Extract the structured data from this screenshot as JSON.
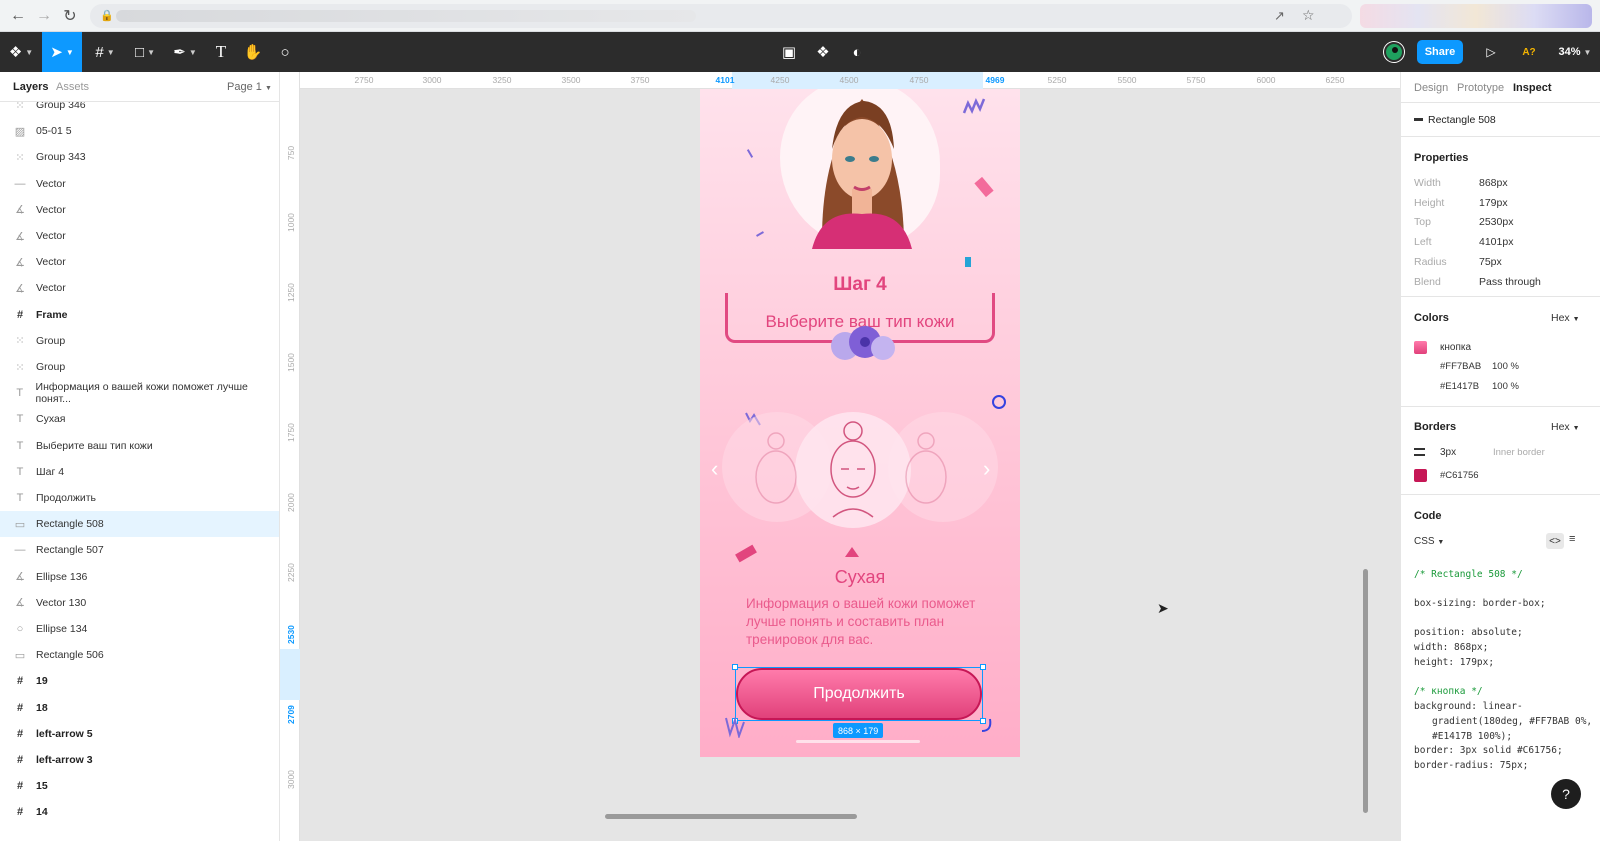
{
  "toolbar": {
    "share_label": "Share",
    "zoom_label": "34%",
    "font_warning": "A?"
  },
  "left_panel": {
    "tabs": [
      "Layers",
      "Assets"
    ],
    "page_selector": "Page 1",
    "layers": [
      {
        "label": "Group 346",
        "icon": "group-icon",
        "bold": false
      },
      {
        "label": "05-01 5",
        "icon": "image-icon",
        "bold": false
      },
      {
        "label": "Group 343",
        "icon": "group-icon",
        "bold": false
      },
      {
        "label": "Vector",
        "icon": "line-icon",
        "bold": false
      },
      {
        "label": "Vector",
        "icon": "vector-icon",
        "bold": false
      },
      {
        "label": "Vector",
        "icon": "vector-icon",
        "bold": false
      },
      {
        "label": "Vector",
        "icon": "vector-icon",
        "bold": false
      },
      {
        "label": "Vector",
        "icon": "vector-icon",
        "bold": false
      },
      {
        "label": "Frame",
        "icon": "frame-icon",
        "bold": true
      },
      {
        "label": "Group",
        "icon": "group-icon",
        "bold": false
      },
      {
        "label": "Group",
        "icon": "group-icon",
        "bold": false
      },
      {
        "label": "Информация о вашей кожи поможет лучше понят...",
        "icon": "text-icon",
        "bold": false
      },
      {
        "label": "Сухая",
        "icon": "text-icon",
        "bold": false
      },
      {
        "label": "Выберите ваш тип кожи",
        "icon": "text-icon",
        "bold": false
      },
      {
        "label": "Шаг 4",
        "icon": "text-icon",
        "bold": false
      },
      {
        "label": "Продолжить",
        "icon": "text-icon",
        "bold": false
      },
      {
        "label": "Rectangle 508",
        "icon": "rectangle-icon",
        "bold": false,
        "selected": true
      },
      {
        "label": "Rectangle 507",
        "icon": "line-icon",
        "bold": false
      },
      {
        "label": "Ellipse 136",
        "icon": "vector-icon",
        "bold": false
      },
      {
        "label": "Vector 130",
        "icon": "vector-icon",
        "bold": false
      },
      {
        "label": "Ellipse 134",
        "icon": "ellipse-icon",
        "bold": false
      },
      {
        "label": "Rectangle 506",
        "icon": "rectangle-icon",
        "bold": false
      },
      {
        "label": "19",
        "icon": "frame-icon",
        "bold": true
      },
      {
        "label": "18",
        "icon": "frame-icon",
        "bold": true
      },
      {
        "label": "left-arrow 5",
        "icon": "frame-icon",
        "bold": true
      },
      {
        "label": "left-arrow 3",
        "icon": "frame-icon",
        "bold": true
      },
      {
        "label": "15",
        "icon": "frame-icon",
        "bold": true
      },
      {
        "label": "14",
        "icon": "frame-icon",
        "bold": true
      }
    ]
  },
  "rulers": {
    "top": [
      "2750",
      "3000",
      "3250",
      "3500",
      "3750",
      "4101",
      "4250",
      "4500",
      "4750",
      "4969",
      "5250",
      "5500",
      "5750",
      "6000",
      "6250"
    ],
    "left": [
      "750",
      "1000",
      "1250",
      "1500",
      "1750",
      "2000",
      "2250",
      "2530",
      "2709",
      "3000"
    ]
  },
  "canvas": {
    "step_title": "Шаг 4",
    "select_title": "Выберите ваш тип кожи",
    "skin_label": "Сухая",
    "skin_description": "Информация о вашей кожи поможет лучше понять и составить план тренировок для вас.",
    "continue_label": "Продолжить",
    "dimension_badge": "868 × 179"
  },
  "right_panel": {
    "tabs": [
      "Design",
      "Prototype",
      "Inspect"
    ],
    "active_tab": "Inspect",
    "layer_name": "Rectangle 508",
    "properties_title": "Properties",
    "properties": [
      {
        "key": "Width",
        "value": "868px"
      },
      {
        "key": "Height",
        "value": "179px"
      },
      {
        "key": "Top",
        "value": "2530px"
      },
      {
        "key": "Left",
        "value": "4101px"
      },
      {
        "key": "Radius",
        "value": "75px"
      },
      {
        "key": "Blend",
        "value": "Pass through"
      }
    ],
    "colors_title": "Colors",
    "color_format": "Hex",
    "style_name": "кнопка",
    "color_stops": [
      {
        "hex": "#FF7BAB",
        "opacity": "100 %"
      },
      {
        "hex": "#E1417B",
        "opacity": "100 %"
      }
    ],
    "borders_title": "Borders",
    "border_format": "Hex",
    "border_width": "3px",
    "border_type": "Inner border",
    "border_color": "#C61756",
    "code_title": "Code",
    "code_lang": "CSS",
    "code_lines": [
      "/* Rectangle 508 */",
      "box-sizing: border-box;",
      "position: absolute;",
      "width: 868px;",
      "height: 179px;",
      "/* кнопка */",
      "background: linear-",
      "gradient(180deg, #FF7BAB 0%,",
      "#E1417B 100%);",
      "border: 3px solid #C61756;",
      "border-radius: 75px;"
    ],
    "help_label": "?"
  },
  "colors": {
    "accent": "#0d99ff",
    "toolbar_bg": "#2c2c2c",
    "button_top": "#FF7BAB",
    "button_bottom": "#E1417B",
    "button_border": "#C61756"
  }
}
